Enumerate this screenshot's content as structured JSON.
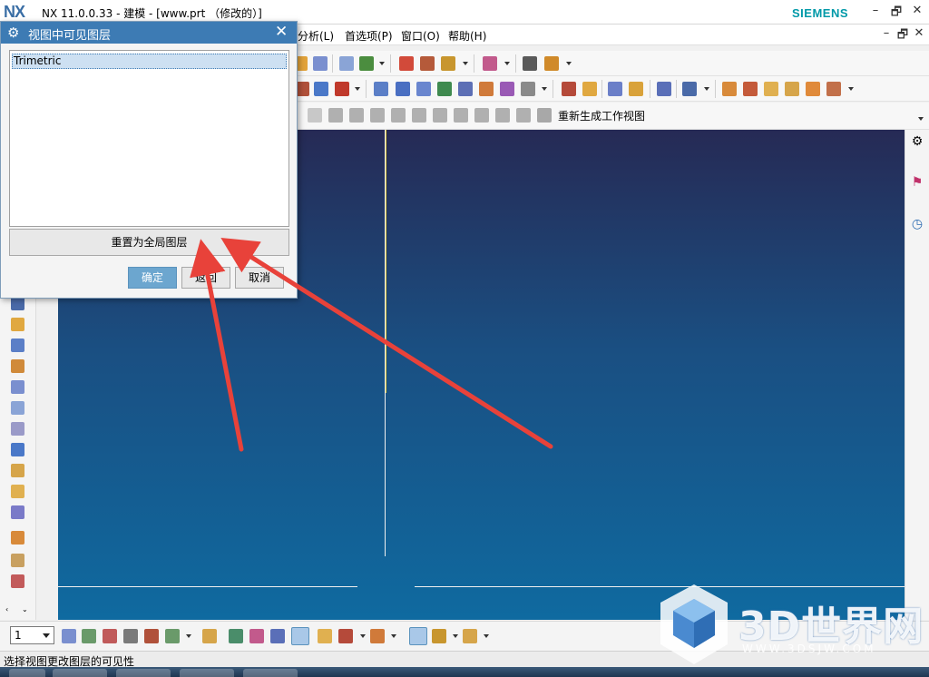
{
  "window": {
    "logo": "NX",
    "title": "NX 11.0.0.33 - 建模 - [www.prt （修改的）]",
    "brand": "SIEMENS",
    "controls": {
      "minimize": "–",
      "restore": "🗗",
      "close": "✕"
    }
  },
  "menubar": {
    "items": [
      "分析(L)",
      "首选项(P)",
      "窗口(O)",
      "帮助(H)"
    ],
    "controls": {
      "minimize": "–",
      "restore": "🗗",
      "close": "✕"
    }
  },
  "toolbar3": {
    "regen_label": "重新生成工作视图"
  },
  "dialog": {
    "title": "视图中可见图层",
    "list_items": [
      "Trimetric"
    ],
    "reset_button": "重置为全局图层",
    "ok_button": "确定",
    "back_button": "返回",
    "cancel_button": "取消"
  },
  "bottombar": {
    "layer_value": "1"
  },
  "status": {
    "text": "选择视图更改图层的可见性"
  },
  "watermark": {
    "text": "3D世界网",
    "url": "WWW.3DSJW.COM"
  },
  "colors": {
    "dialog_header": "#3d7bb4",
    "ok_button": "#6ca6cf",
    "arrow": "#e8423a",
    "viewport_top": "#262a55",
    "viewport_bottom": "#0f6aa0"
  }
}
